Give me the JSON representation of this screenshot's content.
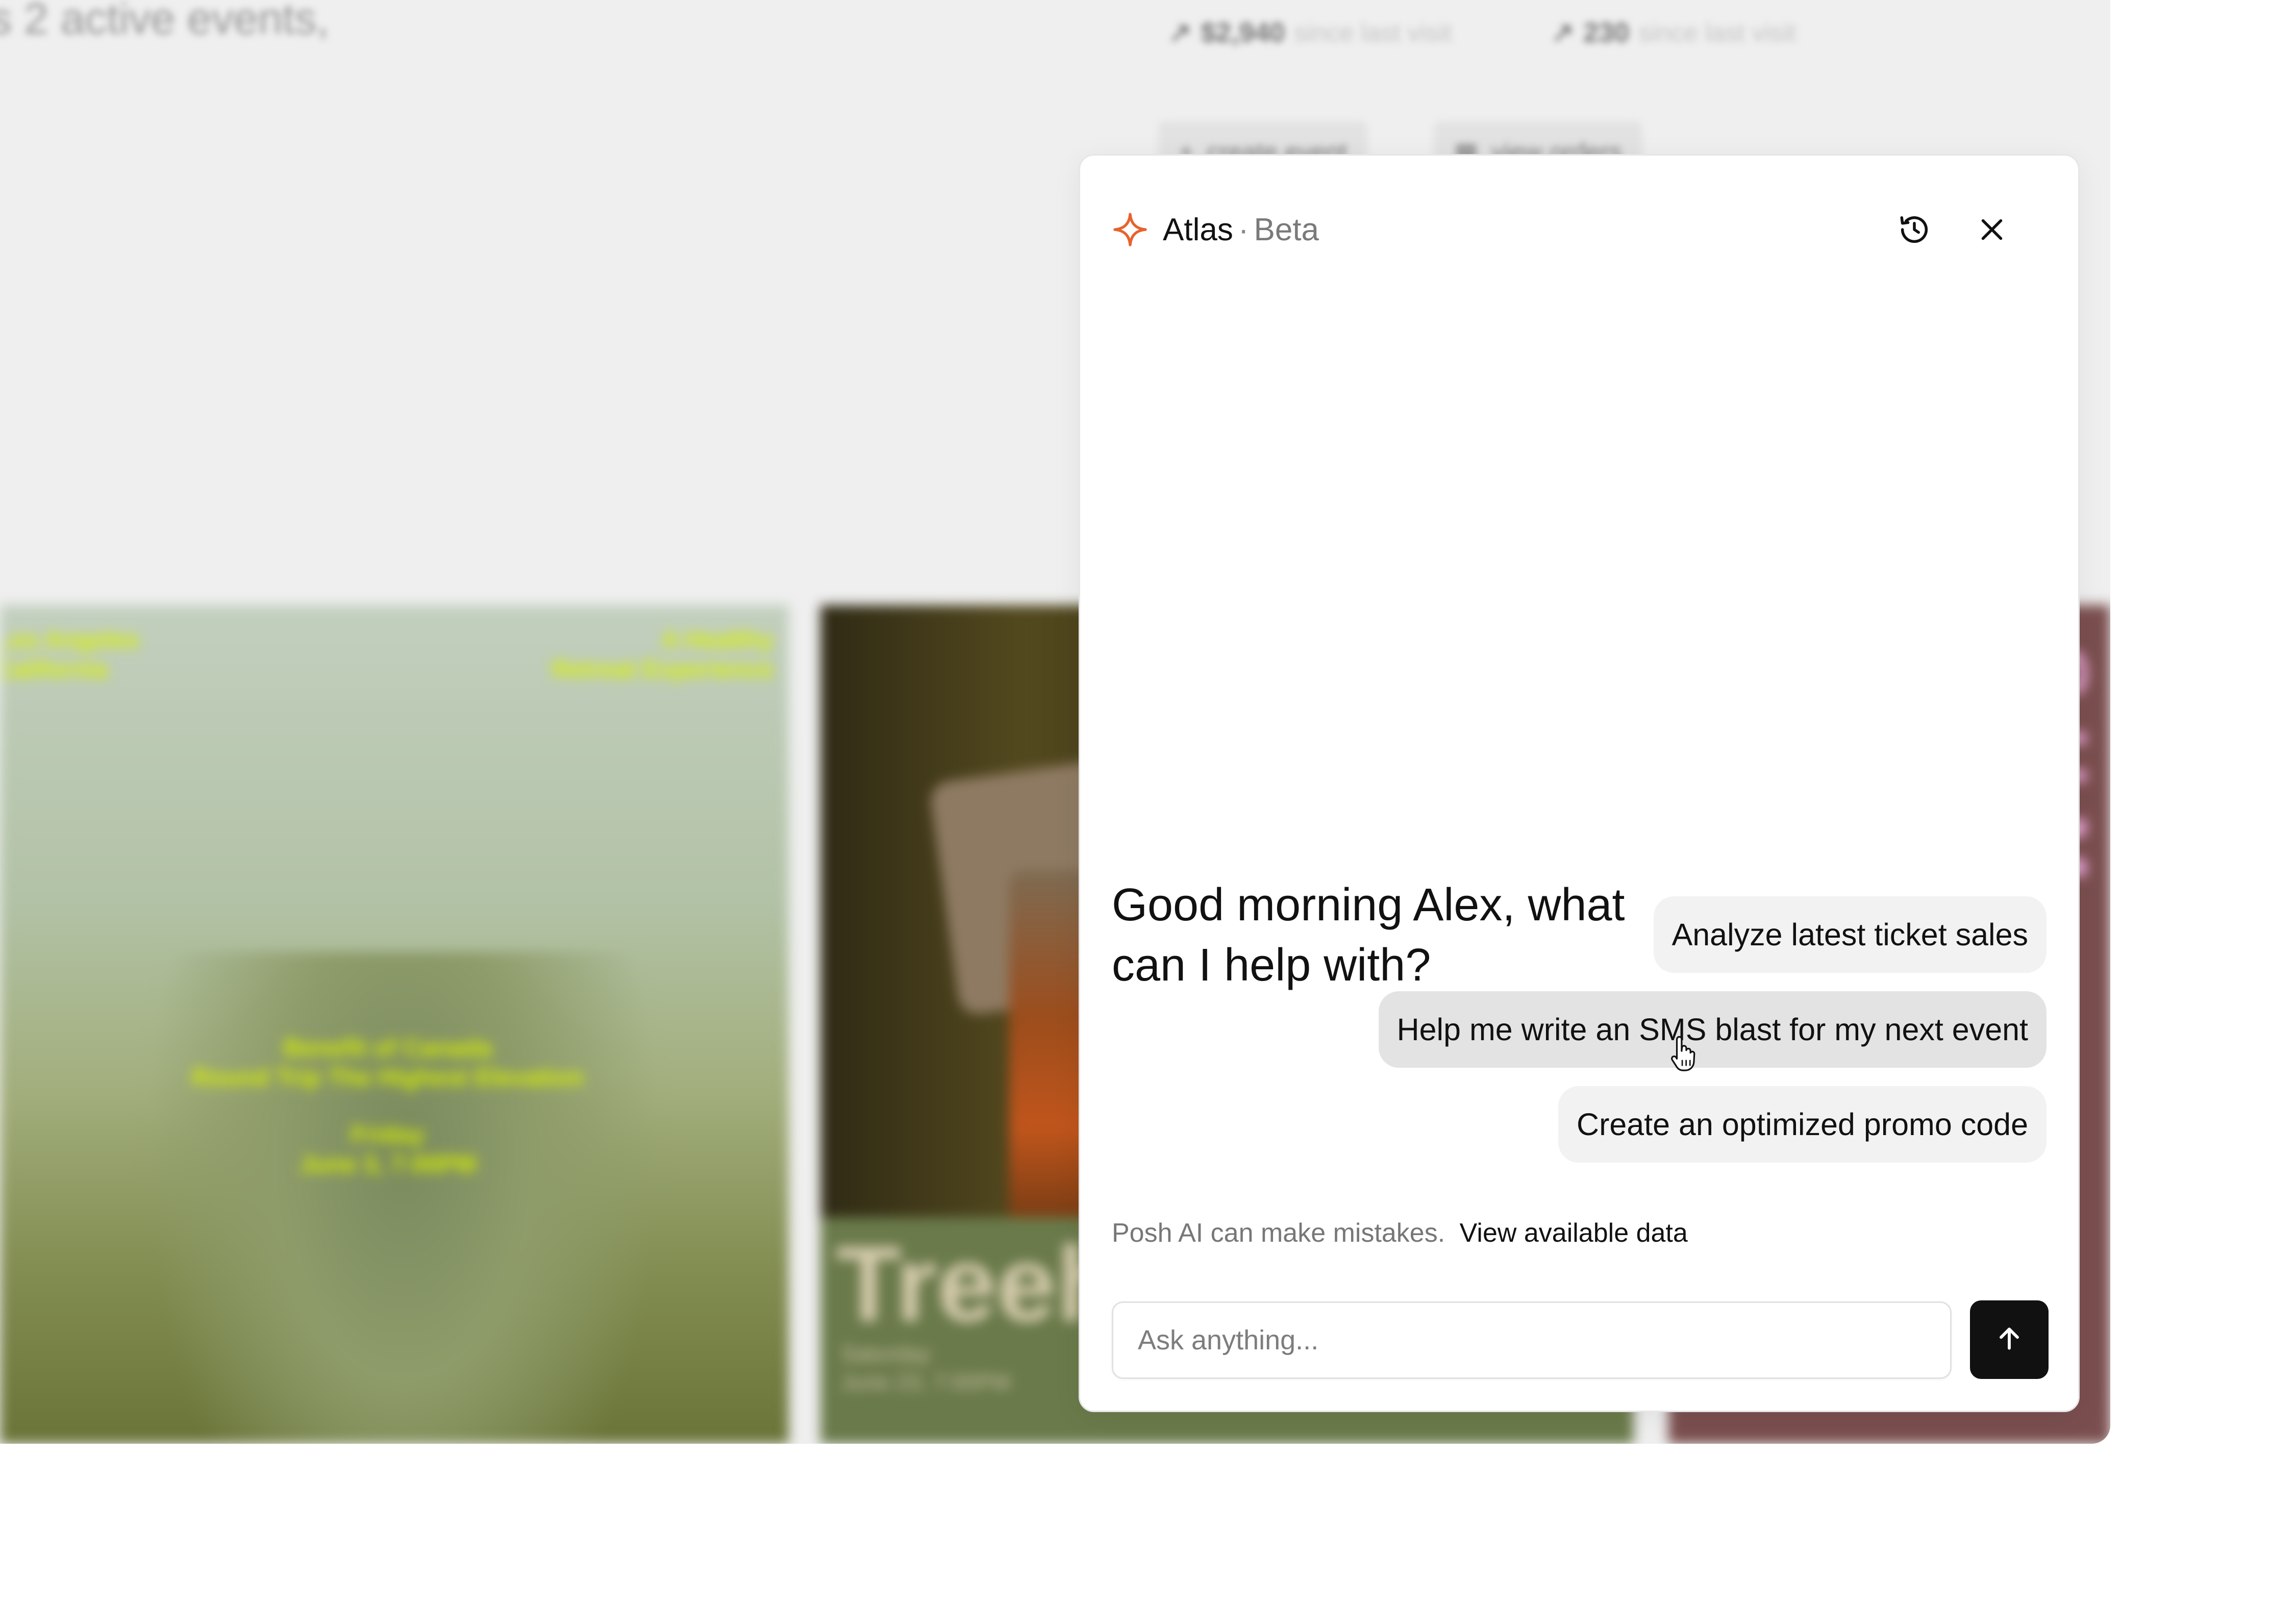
{
  "background": {
    "heading": "s 2 active events,",
    "stats": [
      {
        "value": "$2,940",
        "caption": "since last visit"
      },
      {
        "value": "230",
        "caption": "since last visit"
      }
    ],
    "buttons": [
      {
        "label": "create event",
        "icon": "plus-icon"
      },
      {
        "label": "view orders",
        "icon": "grid-icon"
      }
    ],
    "cards": {
      "mist": {
        "top_left": "Los Angeles\nCalifornia",
        "top_right": "A Healthy\nRetreat Experience",
        "middle": "Benefit of Canada\nRound Trip The Highest Elevation",
        "date": "Friday\nJune 3, 7:00PM"
      },
      "tree": {
        "title": "Treeh",
        "date": "Saturday\nJune 23, 7:00PM"
      }
    }
  },
  "atlas": {
    "title": "Atlas",
    "separator": "·",
    "badge": "Beta",
    "greeting": "Good morning Alex, what can I help with?",
    "suggestions": [
      "Analyze latest ticket sales",
      "Help me write an SMS blast for my next event",
      "Create an optimized promo code"
    ],
    "disclaimer": "Posh AI can make mistakes.",
    "link": "View available data",
    "input": {
      "placeholder": "Ask anything...",
      "value": ""
    },
    "icons": {
      "logo": "sparkle-icon",
      "history": "history-icon",
      "close": "close-icon",
      "send": "arrow-up-icon"
    },
    "accent_color": "#E8622C"
  }
}
